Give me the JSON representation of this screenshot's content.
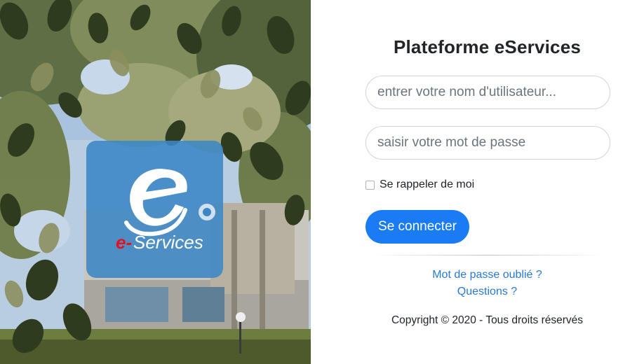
{
  "hero": {
    "logo_letter": "e",
    "logo_text_prefix": "e-",
    "logo_text_suffix": "Services"
  },
  "login": {
    "title": "Plateforme eServices",
    "username_placeholder": "entrer votre nom d'utilisateur...",
    "password_placeholder": "saisir votre mot de passe",
    "remember_label": "Se rappeler de moi",
    "submit_label": "Se connecter",
    "forgot_password_link": "Mot de passe oublié ?",
    "questions_link": "Questions ?",
    "copyright": "Copyright © 2020 - Tous droits réservés"
  },
  "colors": {
    "primary_button": "#1a7cf5",
    "link": "#2a79d6",
    "logo_tile": "#3b86c6",
    "logo_accent_red": "#e2131f"
  }
}
